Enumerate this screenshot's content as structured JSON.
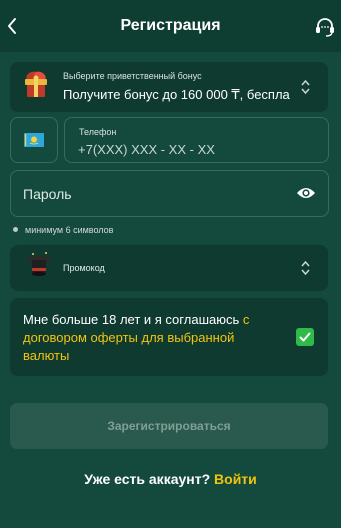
{
  "header": {
    "title": "Регистрация",
    "back_icon": "chevron-left-icon",
    "support_icon": "headset-icon"
  },
  "bonus": {
    "label": "Выберите приветственный бонус",
    "value": "Получите бонус до 160 000 ₸, беспла",
    "icon": "gift-icon"
  },
  "phone": {
    "country_icon": "kazakhstan-flag-icon",
    "label": "Телефон",
    "placeholder": "+7(XXX) XXX - XX - XX",
    "value": ""
  },
  "password": {
    "placeholder": "Пароль",
    "value": "",
    "hint": "минимум 6 символов",
    "icon": "eye-icon"
  },
  "promo": {
    "label": "Промокод",
    "icon": "magic-hat-icon"
  },
  "agreement": {
    "text_prefix": "Мне больше 18 лет и я соглашаюсь ",
    "link_text": "с договором оферты для выбранной валюты",
    "checked": true
  },
  "register_button": {
    "label": "Зарегистрироваться"
  },
  "login": {
    "prompt": "Уже есть аккаунт?",
    "link": "Войти"
  },
  "colors": {
    "background": "#14493d",
    "header": "#0e3d31",
    "card": "#0f3a2f",
    "accent_yellow": "#f1c40f",
    "checkbox_green": "#2fba4a",
    "button_disabled": "#2a5a4d"
  }
}
